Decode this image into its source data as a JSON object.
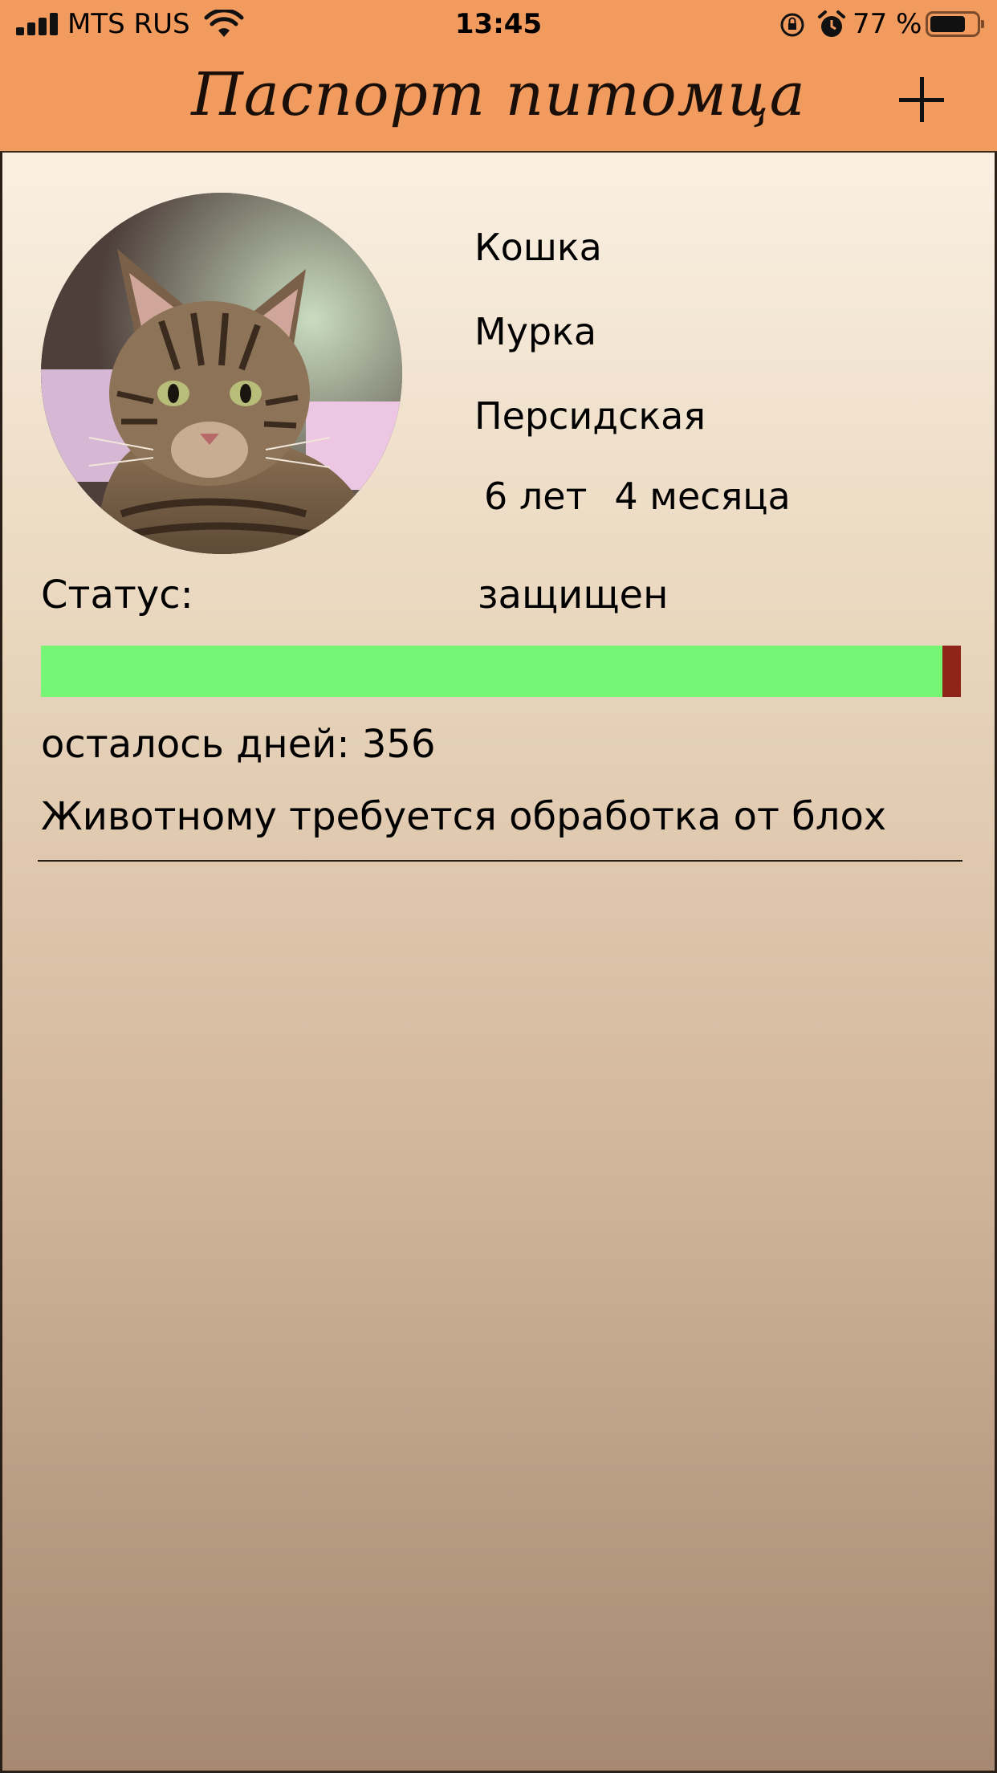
{
  "status_bar": {
    "carrier": "MTS RUS",
    "time": "13:45",
    "battery_percent": "77 %",
    "battery_level": 0.77
  },
  "nav": {
    "title": "Паспорт питомца",
    "add_icon": "plus-icon"
  },
  "pet": {
    "photo_alt": "cat-photo",
    "species": "Кошка",
    "name": "Мурка",
    "breed": "Персидская",
    "age_years": "6 лет",
    "age_months": "4 месяца"
  },
  "protection": {
    "status_label": "Статус:",
    "status_value": "защищен",
    "days_label": "осталось дней:",
    "days_value": "356",
    "progress_fraction": 0.98,
    "progress_color": "#77f574",
    "progress_track_color": "#8f2518",
    "warning": "Животному требуется обработка от блох"
  },
  "colors": {
    "nav_background": "#f19b5f",
    "content_top": "#faf0e2",
    "content_bottom": "#a78871"
  }
}
